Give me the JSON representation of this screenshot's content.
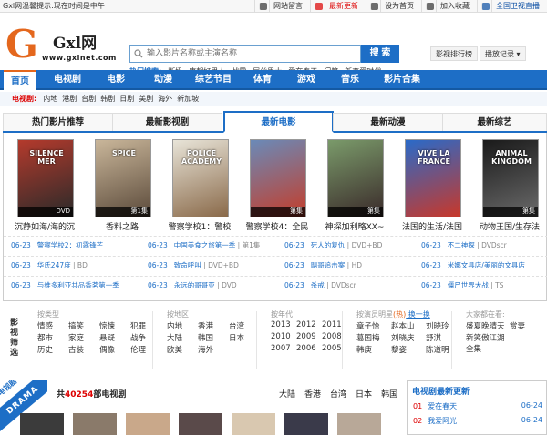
{
  "topbar": {
    "greeting": "Gxl网温馨提示:现在时间是中午",
    "links": [
      "网站留言",
      "最新更新",
      "设为首页",
      "加入收藏",
      "全国卫视直播"
    ],
    "link_colors": [
      "#333333",
      "#dd0000",
      "#333333",
      "#333333",
      "#0a4ea3"
    ],
    "icon_names": [
      "message-icon",
      "update-icon",
      "home-icon",
      "favorite-icon",
      "tv-icon"
    ]
  },
  "logo": {
    "letter": "G",
    "name": "Gxl网",
    "url": "www.gxlnet.com"
  },
  "search": {
    "placeholder": "输入影片名称或主演名称",
    "button": "搜 索"
  },
  "hot": {
    "label": "热门搜索:",
    "words": [
      "断奶",
      "唐朝好男人",
      "战雷",
      "屌丝男士",
      "爱在春天",
      "门第",
      "新恋爱时代"
    ]
  },
  "header_buttons": [
    "影视排行榜",
    "播放记录 ▾"
  ],
  "nav": [
    "首页",
    "电视剧",
    "电影",
    "动漫",
    "综艺节目",
    "体育",
    "游戏",
    "音乐",
    "影片合集"
  ],
  "subnav": {
    "label": "电视剧:",
    "items": [
      "内地",
      "港剧",
      "台剧",
      "韩剧",
      "日剧",
      "美剧",
      "海外",
      "新加坡"
    ]
  },
  "tabs": [
    "热门影片推荐",
    "最新影视剧",
    "最新电影",
    "最新动漫",
    "最新综艺"
  ],
  "posters": [
    {
      "title": "沉静如海/海的沉",
      "label": "DVD",
      "colors": [
        "#b43a2c",
        "#2a2a2a"
      ],
      "text": "SILENCE MER"
    },
    {
      "title": "香料之路",
      "label": "第1集",
      "colors": [
        "#c9b69a",
        "#5b4a3a"
      ],
      "text": "SPICE"
    },
    {
      "title": "警察学校1：警校",
      "label": "",
      "colors": [
        "#e8e4d8",
        "#8a6a4a"
      ],
      "text": "POLICE ACADEMY"
    },
    {
      "title": "警察学校4：全民",
      "label": "第集",
      "colors": [
        "#6a8ab8",
        "#c43d2a"
      ],
      "text": ""
    },
    {
      "title": "神探加利略XX~",
      "label": "第集",
      "colors": [
        "#7a9a6a",
        "#3a2a2a"
      ],
      "text": ""
    },
    {
      "title": "法国的生活/法国",
      "label": "",
      "colors": [
        "#2a6ac8",
        "#c8382a"
      ],
      "text": "VIVE LA FRANCE"
    },
    {
      "title": "动物王国/生存法",
      "label": "第集",
      "colors": [
        "#1a1a1a",
        "#6a6a6a"
      ],
      "text": "ANIMAL KINGDOM"
    }
  ],
  "list": [
    [
      {
        "date": "06-23",
        "name": "警察学校2：初露锋芒",
        "status": ""
      },
      {
        "date": "06-23",
        "name": "中国美食之旅第一季",
        "status": "第1集"
      },
      {
        "date": "06-23",
        "name": "死人的复仇",
        "status": "DVD+BD"
      },
      {
        "date": "06-23",
        "name": "不二神探",
        "status": "DVDscr"
      }
    ],
    [
      {
        "date": "06-23",
        "name": "华氏247度",
        "status": "BD"
      },
      {
        "date": "06-23",
        "name": "致命呼叫",
        "status": "DVD+BD"
      },
      {
        "date": "06-23",
        "name": "飓哥追击案",
        "status": "HD"
      },
      {
        "date": "06-23",
        "name": "米娜文具店/美丽的文具店",
        "status": ""
      }
    ],
    [
      {
        "date": "06-23",
        "name": "与维多利亚共品香茗第一季",
        "status": ""
      },
      {
        "date": "06-23",
        "name": "永远的哥哥亚",
        "status": "DVD"
      },
      {
        "date": "06-23",
        "name": "杀戒",
        "status": "DVDscr"
      },
      {
        "date": "06-23",
        "name": "僵尸世界大战",
        "status": "TS"
      }
    ]
  ],
  "filters": {
    "side": [
      "影",
      "视",
      "筛",
      "选"
    ],
    "type": {
      "head": "按类型",
      "items": [
        "情感",
        "搞笑",
        "惊悚",
        "犯罪",
        "都市",
        "家庭",
        "悬疑",
        "战争",
        "历史",
        "古装",
        "偶像",
        "伦理"
      ]
    },
    "region": {
      "head": "按地区",
      "items": [
        "内地",
        "香港",
        "台湾",
        "大陆",
        "韩国",
        "日本",
        "欧美",
        "海外"
      ]
    },
    "year": {
      "head": "按年代",
      "items": [
        "2013",
        "2012",
        "2011",
        "2010",
        "2009",
        "2008",
        "2007",
        "2006",
        "2005"
      ]
    },
    "star": {
      "head": "按演员明星",
      "hot": "(热)",
      "change": "换一换",
      "items": [
        "章子怡",
        "赵本山",
        "刘晓玲",
        "葛国梅",
        "刘晓庆",
        "舒淇",
        "韩庚",
        "黎姿",
        "陈道明"
      ]
    },
    "city": {
      "head": "大家都在看:",
      "items": [
        "盛夏晚晴天",
        "赏妻",
        "新笑傲江湖全集"
      ]
    }
  },
  "tv": {
    "ribbon": "DRAMA",
    "ribbon_cn": "电视剧",
    "prefix": "共",
    "count": "40254",
    "suffix": "部电视剧",
    "regions": [
      "大陆",
      "香港",
      "台湾",
      "日本",
      "韩国"
    ]
  },
  "latest": {
    "title": "电视剧最新更新",
    "rows": [
      {
        "idx": "01",
        "name": "爱在春天",
        "date": "06-24"
      },
      {
        "idx": "02",
        "name": "我爱阿光",
        "date": "06-24"
      }
    ]
  }
}
